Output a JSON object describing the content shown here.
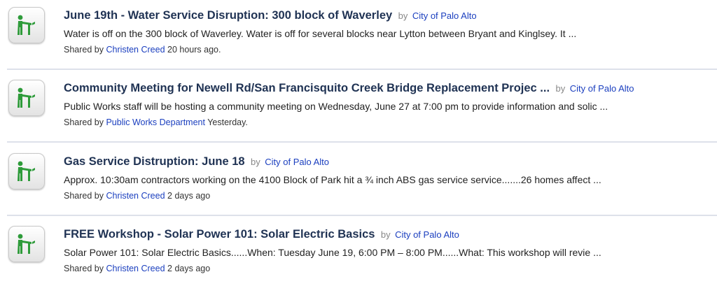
{
  "feed": {
    "icon_name": "walking-person-icon",
    "items": [
      {
        "title": "June 19th - Water Service Disruption: 300 block of Waverley",
        "by_label": "by",
        "source": "City of Palo Alto",
        "snippet": "Water is off on the 300 block of Waverley. Water is off for several blocks near Lytton between Bryant and Kinglsey. It ...",
        "shared_label": "Shared by",
        "sharer": "Christen Creed",
        "time": "20 hours ago."
      },
      {
        "title": "Community Meeting for Newell Rd/San Francisquito Creek Bridge Replacement Projec ...",
        "by_label": "by",
        "source": "City of Palo Alto",
        "snippet": "Public Works staff will be hosting a community meeting on Wednesday, June 27 at 7:00 pm to provide information and solic ...",
        "shared_label": "Shared by",
        "sharer": "Public Works Department",
        "time": "Yesterday."
      },
      {
        "title": "Gas Service Distruption: June 18",
        "by_label": "by",
        "source": "City of Palo Alto",
        "snippet": "Approx. 10:30am contractors working on the 4100 Block of Park hit a ¾ inch ABS gas service service.......26 homes affect ...",
        "shared_label": "Shared by",
        "sharer": "Christen Creed",
        "time": "2 days ago"
      },
      {
        "title": "FREE Workshop - Solar Power 101: Solar Electric Basics",
        "by_label": "by",
        "source": "City of Palo Alto",
        "snippet": "Solar Power 101: Solar Electric Basics......When: Tuesday June 19, 6:00 PM – 8:00 PM......What: This workshop will revie ...",
        "shared_label": "Shared by",
        "sharer": "Christen Creed",
        "time": "2 days ago"
      }
    ]
  },
  "colors": {
    "title": "#1f3253",
    "link": "#1b3fbf",
    "icon_green": "#2e9b3a",
    "divider": "#dde1ea"
  }
}
